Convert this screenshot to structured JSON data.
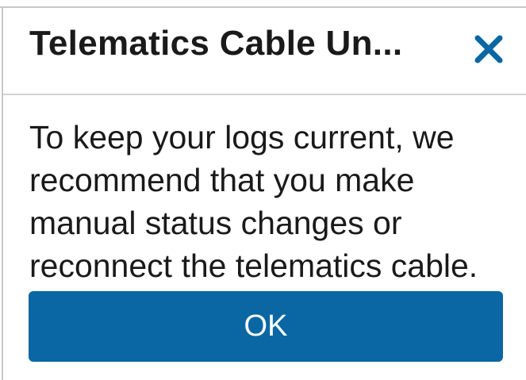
{
  "dialog": {
    "title": "Telematics Cable Un...",
    "close_icon": "close-icon",
    "message": "To keep your logs current, we recommend that you make manual status changes or reconnect the telematics cable.",
    "ok_label": "OK"
  },
  "colors": {
    "accent": "#0a67a3",
    "close_icon": "#0a67a3",
    "text": "#1a1a1a",
    "divider": "#d2d2d2"
  }
}
